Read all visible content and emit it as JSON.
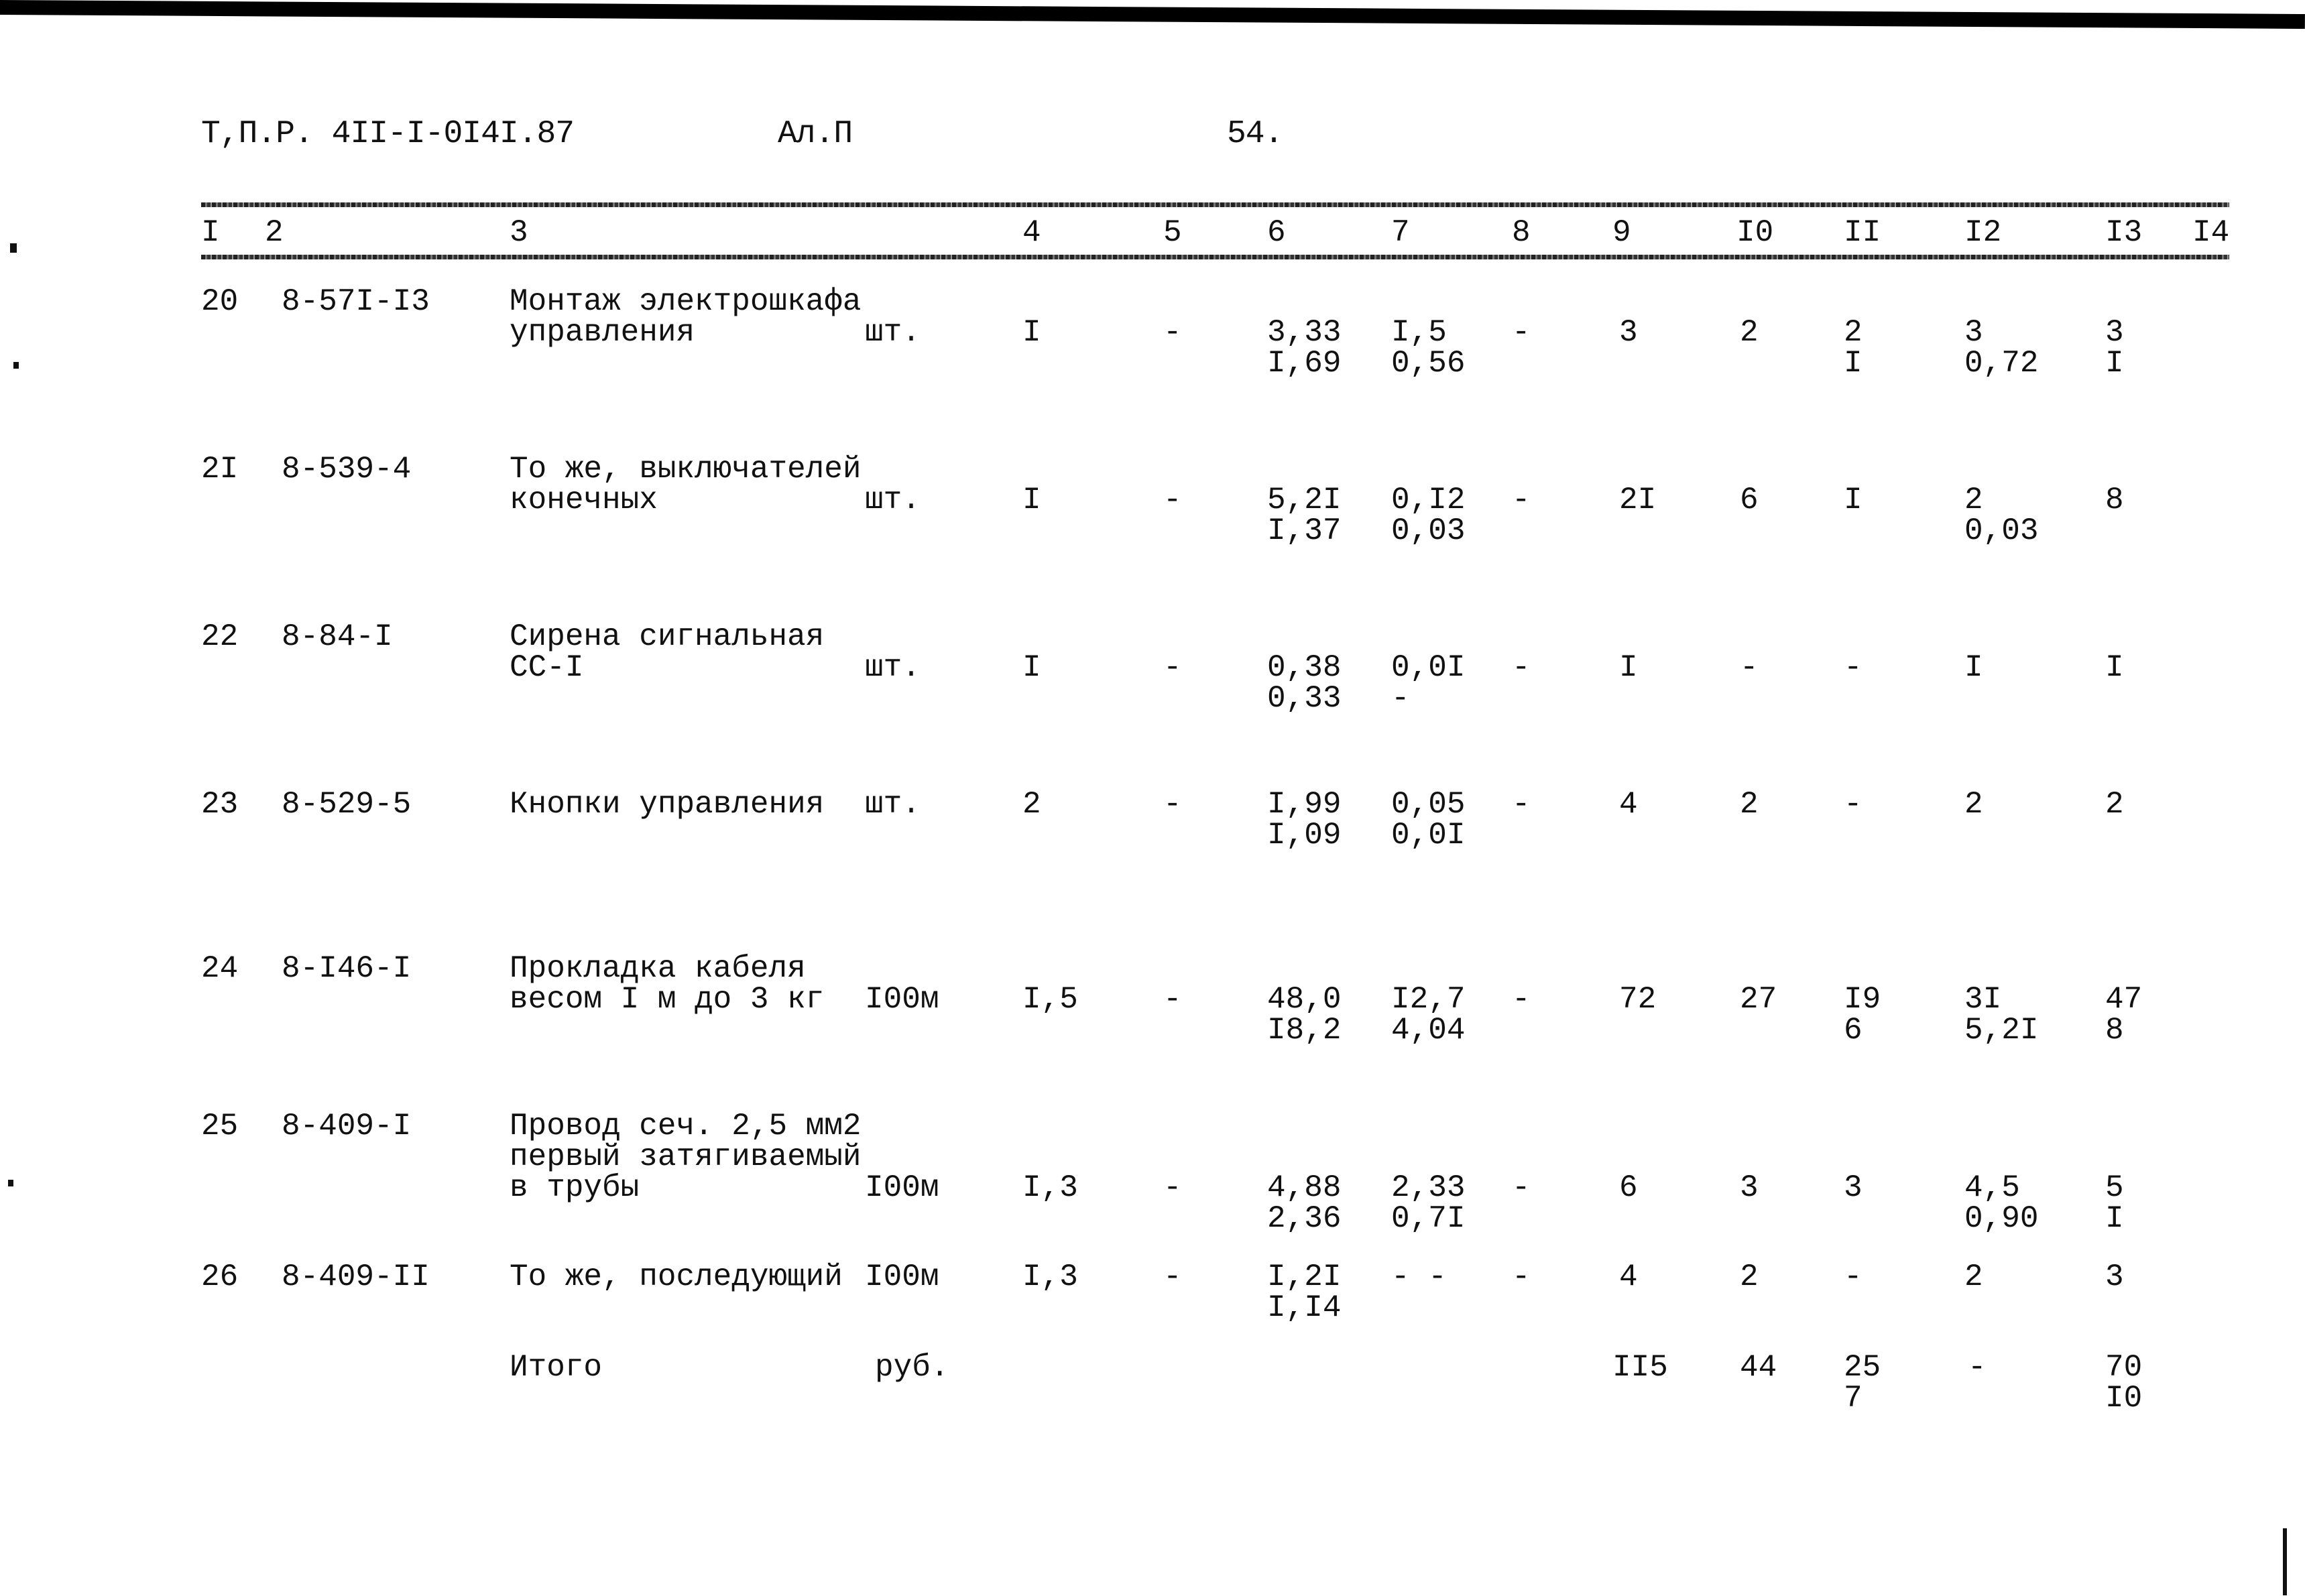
{
  "header": {
    "doc_code": "Т,П.Р. 4II-I-0I4I.87",
    "album": "Ал.П",
    "page": "54."
  },
  "columns": [
    "I",
    "2",
    "3",
    "4",
    "5",
    "6",
    "7",
    "8",
    "9",
    "I0",
    "II",
    "I2",
    "I3",
    "I4"
  ],
  "rows": [
    {
      "n": "20",
      "code": "8-57I-I3",
      "desc": [
        "Монтаж электрошкафа",
        "управления"
      ],
      "unit": "шт.",
      "qty": "I",
      "c5": "-",
      "c6": [
        "3,33",
        "I,69"
      ],
      "c7": [
        "I,5",
        "0,56"
      ],
      "c8": "-",
      "c9": "3",
      "c10": "2",
      "c11": [
        "2",
        "I"
      ],
      "c12": [
        "3",
        "0,72"
      ],
      "c13": [
        "3",
        "I"
      ]
    },
    {
      "n": "2I",
      "code": "8-539-4",
      "desc": [
        "То же, выключателей",
        "конечных"
      ],
      "unit": "шт.",
      "qty": "I",
      "c5": "-",
      "c6": [
        "5,2I",
        "I,37"
      ],
      "c7": [
        "0,I2",
        "0,03"
      ],
      "c8": "-",
      "c9": "2I",
      "c10": "6",
      "c11": [
        "I"
      ],
      "c12": [
        "2",
        "0,03"
      ],
      "c13": [
        "8"
      ]
    },
    {
      "n": "22",
      "code": "8-84-I",
      "desc": [
        "Сирена сигнальная",
        "СС-I"
      ],
      "unit": "шт.",
      "qty": "I",
      "c5": "-",
      "c6": [
        "0,38",
        "0,33"
      ],
      "c7": [
        "0,0I",
        "-"
      ],
      "c8": "-",
      "c9": "I",
      "c10": "-",
      "c11": [
        "-"
      ],
      "c12": [
        "I"
      ],
      "c13": [
        "I"
      ]
    },
    {
      "n": "23",
      "code": "8-529-5",
      "desc": [
        "Кнопки управления"
      ],
      "unit": "шт.",
      "qty": "2",
      "c5": "-",
      "c6": [
        "I,99",
        "I,09"
      ],
      "c7": [
        "0,05",
        "0,0I"
      ],
      "c8": "-",
      "c9": "4",
      "c10": "2",
      "c11": [
        "-"
      ],
      "c12": [
        "2"
      ],
      "c13": [
        "2"
      ]
    },
    {
      "n": "24",
      "code": "8-I46-I",
      "desc": [
        "Прокладка кабеля",
        "весом I м до 3 кг"
      ],
      "unit": "I00м",
      "qty": "I,5",
      "c5": "-",
      "c6": [
        "48,0",
        "I8,2"
      ],
      "c7": [
        "I2,7",
        "4,04"
      ],
      "c8": "-",
      "c9": "72",
      "c10": "27",
      "c11": [
        "I9",
        "6"
      ],
      "c12": [
        "3I",
        "5,2I"
      ],
      "c13": [
        "47",
        "8"
      ]
    },
    {
      "n": "25",
      "code": "8-409-I",
      "desc": [
        "Провод сеч. 2,5 мм2",
        "первый затягиваемый",
        "в трубы"
      ],
      "unit": "I00м",
      "qty": "I,3",
      "c5": "-",
      "c6": [
        "4,88",
        "2,36"
      ],
      "c7": [
        "2,33",
        "0,7I"
      ],
      "c8": "-",
      "c9": "6",
      "c10": "3",
      "c11": [
        "3"
      ],
      "c12": [
        "4,5",
        "0,90"
      ],
      "c13": [
        "5",
        "I"
      ]
    },
    {
      "n": "26",
      "code": "8-409-II",
      "desc": [
        "То же, последующий"
      ],
      "unit": "I00м",
      "qty": "I,3",
      "c5": "-",
      "c6": [
        "I,2I",
        "I,I4"
      ],
      "c7": [
        "- -"
      ],
      "c8": "-",
      "c9": "4",
      "c10": "2",
      "c11": [
        "-"
      ],
      "c12": [
        "2"
      ],
      "c13": [
        "3"
      ]
    }
  ],
  "total": {
    "label": "Итого",
    "unit": "руб.",
    "c9": "II5",
    "c10": "44",
    "c11": [
      "25",
      "7"
    ],
    "c12": "-",
    "c13": [
      "70",
      "I0"
    ]
  }
}
